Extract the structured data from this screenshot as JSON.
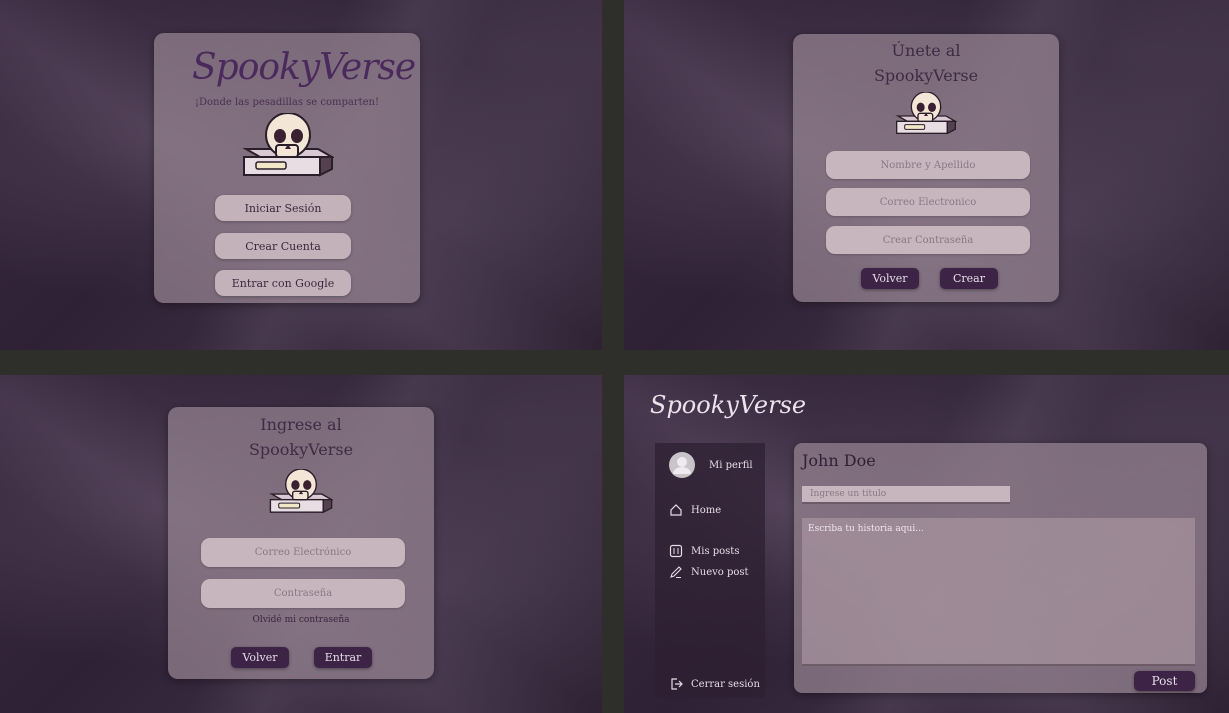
{
  "brand": "SpookyVerse",
  "home": {
    "tagline": "¡Donde las pesadillas se comparten!",
    "login_button": "Iniciar Sesión",
    "signup_button": "Crear Cuenta",
    "google_button": "Entrar con Google"
  },
  "signup": {
    "title_line1": "Únete al",
    "title_line2": "SpookyVerse",
    "name_placeholder": "Nombre y Apellido",
    "email_placeholder": "Correo Electronico",
    "password_placeholder": "Crear Contraseña",
    "back_button": "Volver",
    "create_button": "Crear"
  },
  "login": {
    "title_line1": "Ingrese al",
    "title_line2": "SpookyVerse",
    "email_placeholder": "Correo Electrónico",
    "password_placeholder": "Contraseña",
    "forgot_link": "Olvidé mi contraseña",
    "back_button": "Volver",
    "enter_button": "Entrar"
  },
  "dashboard": {
    "sidebar": {
      "profile": "Mi perfil",
      "items": [
        {
          "label": "Home",
          "icon": "home-icon"
        },
        {
          "label": "Mis posts",
          "icon": "posts-icon"
        },
        {
          "label": "Nuevo post",
          "icon": "pencil-icon"
        }
      ],
      "logout": "Cerrar sesión"
    },
    "user_name": "John Doe",
    "title_placeholder": "Ingrese un título",
    "story_placeholder": "Escriba tu historia aqui...",
    "post_button": "Post"
  },
  "colors": {
    "card": "#968491",
    "dark_button": "#3d2447",
    "light_button": "#c4b2ba",
    "brand": "#4a2a5c"
  }
}
